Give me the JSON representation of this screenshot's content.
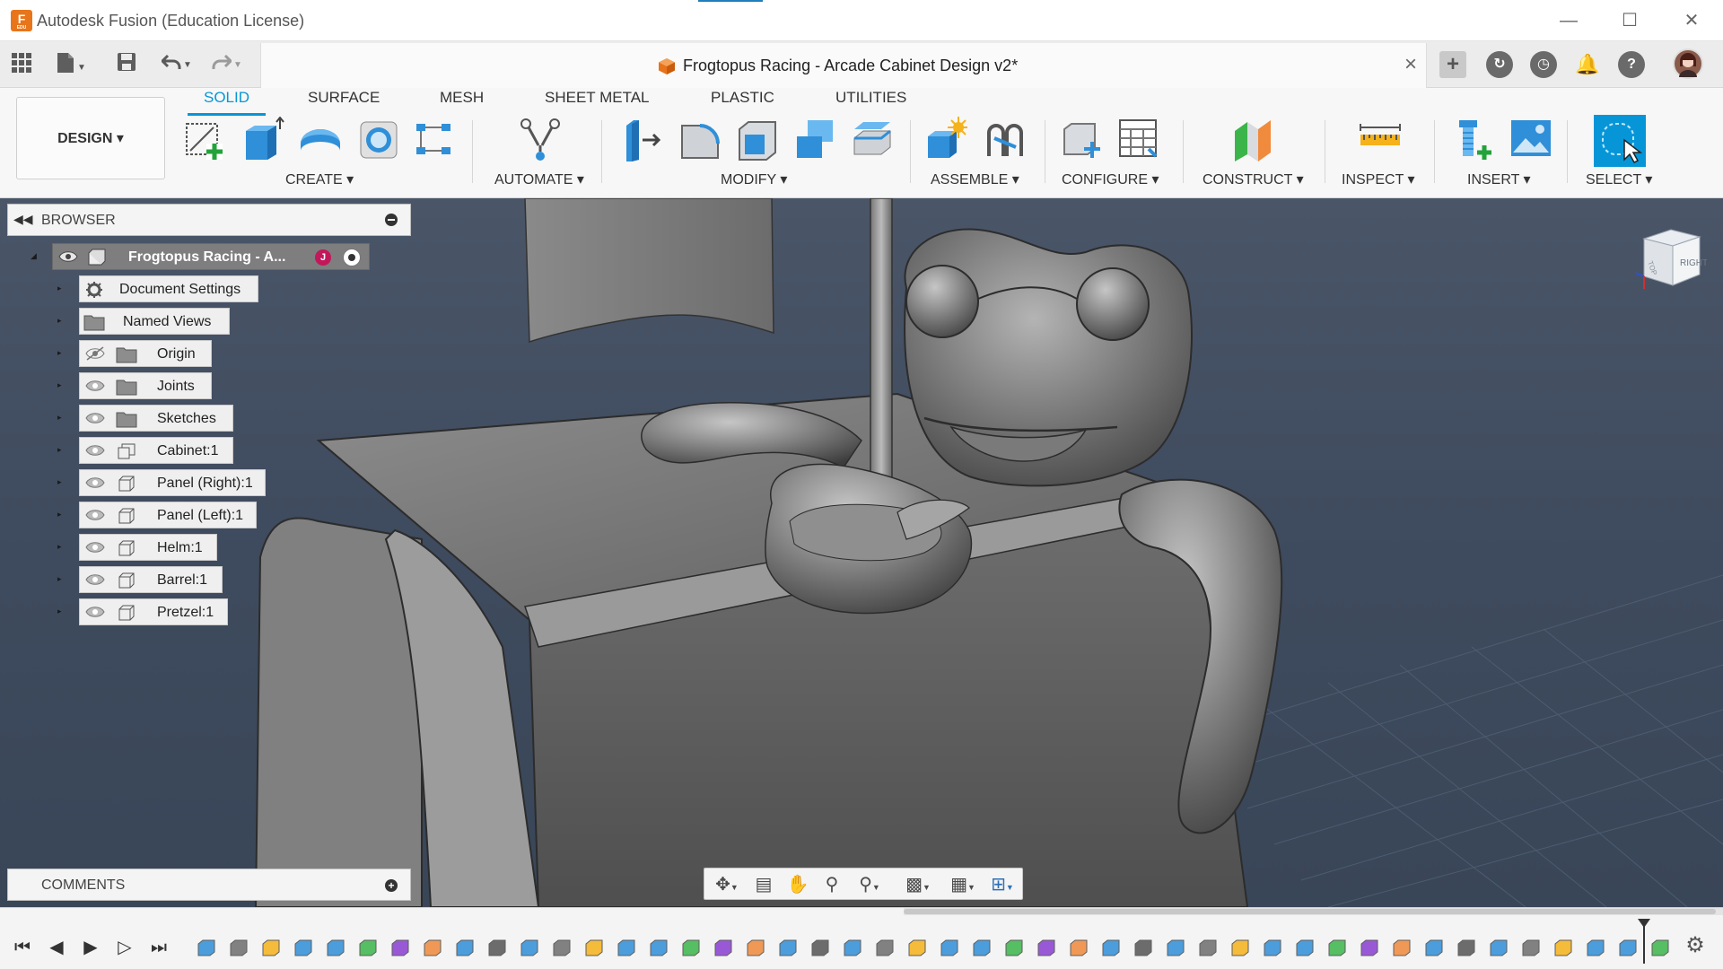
{
  "window": {
    "title": "Autodesk Fusion (Education License)",
    "app_icon_letter": "F",
    "app_icon_sub": "EDU",
    "controls": [
      "minimize",
      "maximize",
      "close"
    ]
  },
  "quick_access": {
    "items": [
      "apps-grid-icon",
      "file-icon",
      "save-icon",
      "undo-icon",
      "redo-icon"
    ],
    "right_items": [
      "new-tab-plus-icon",
      "extensions-icon",
      "job-status-icon",
      "notifications-bell-icon",
      "help-icon",
      "user-avatar"
    ]
  },
  "document_tab": {
    "title": "Frogtopus Racing - Arcade Cabinet Design v2*",
    "close_label": "×"
  },
  "ribbon": {
    "workspace": "DESIGN",
    "tabs": [
      {
        "label": "SOLID",
        "active": true
      },
      {
        "label": "SURFACE",
        "active": false
      },
      {
        "label": "MESH",
        "active": false
      },
      {
        "label": "SHEET METAL",
        "active": false
      },
      {
        "label": "PLASTIC",
        "active": false
      },
      {
        "label": "UTILITIES",
        "active": false
      }
    ],
    "groups": [
      {
        "label": "CREATE",
        "icons": [
          "create-sketch-icon",
          "extrude-icon",
          "revolve-icon",
          "hole-icon",
          "pattern-icon"
        ]
      },
      {
        "label": "AUTOMATE",
        "icons": [
          "automate-icon"
        ]
      },
      {
        "label": "MODIFY",
        "icons": [
          "press-pull-icon",
          "fillet-icon",
          "shell-icon",
          "combine-icon",
          "offset-face-icon"
        ]
      },
      {
        "label": "ASSEMBLE",
        "icons": [
          "new-component-icon",
          "joint-icon"
        ]
      },
      {
        "label": "CONFIGURE",
        "icons": [
          "configure-icon",
          "configure-table-icon"
        ]
      },
      {
        "label": "CONSTRUCT",
        "icons": [
          "construct-plane-icon"
        ]
      },
      {
        "label": "INSPECT",
        "icons": [
          "measure-icon"
        ]
      },
      {
        "label": "INSERT",
        "icons": [
          "insert-mcmaster-icon",
          "insert-canvas-icon"
        ]
      },
      {
        "label": "SELECT",
        "icons": [
          "select-icon"
        ]
      }
    ],
    "accent": "#0696d7"
  },
  "browser": {
    "title": "BROWSER",
    "root": {
      "label": "Frogtopus Racing - A...",
      "badge": "J"
    },
    "nodes": [
      {
        "label": "Document Settings",
        "icon": "gear-icon",
        "visible": null
      },
      {
        "label": "Named Views",
        "icon": "folder-icon",
        "visible": null
      },
      {
        "label": "Origin",
        "icon": "folder-icon",
        "visible": false
      },
      {
        "label": "Joints",
        "icon": "folder-icon",
        "visible": true
      },
      {
        "label": "Sketches",
        "icon": "folder-icon",
        "visible": true
      },
      {
        "label": "Cabinet:1",
        "icon": "component-icon",
        "visible": true
      },
      {
        "label": "Panel (Right):1",
        "icon": "component-icon",
        "visible": true
      },
      {
        "label": "Panel (Left):1",
        "icon": "component-icon",
        "visible": true
      },
      {
        "label": "Helm:1",
        "icon": "component-icon",
        "visible": true
      },
      {
        "label": "Barrel:1",
        "icon": "component-icon",
        "visible": true
      },
      {
        "label": "Pretzel:1",
        "icon": "component-icon",
        "visible": true
      }
    ]
  },
  "comments": {
    "title": "COMMENTS"
  },
  "viewcube": {
    "face_label": "RIGHT",
    "top_label": "TOP"
  },
  "navbar": {
    "items": [
      "orbit-icon",
      "look-at-icon",
      "pan-icon",
      "zoom-icon",
      "zoom-window-icon",
      "display-settings-icon",
      "grid-icon",
      "viewports-icon"
    ]
  },
  "timeline": {
    "controls": [
      "go-to-start-icon",
      "step-back-icon",
      "play-icon",
      "step-forward-icon",
      "go-to-end-icon"
    ],
    "feature_count": 46,
    "settings_icon": "gear-icon"
  }
}
